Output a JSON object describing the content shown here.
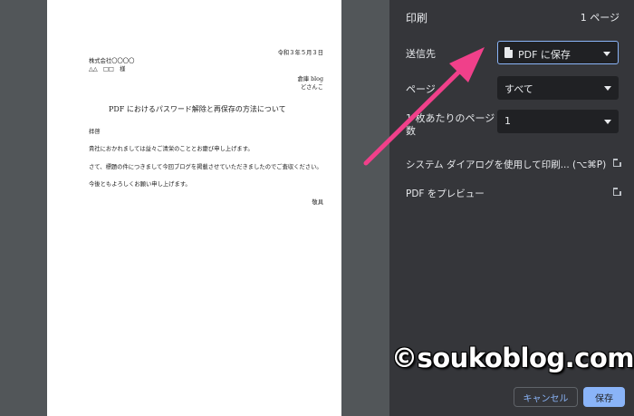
{
  "document": {
    "date": "令和３年５月３日",
    "company": "株式会社〇〇〇〇",
    "recipient": "△△　□□　様",
    "sender_blog": "倉庫 blog",
    "sender_name": "どさんこ",
    "title": "PDF におけるパスワード解除と再保存の方法について",
    "greeting": "拝啓",
    "para1": "貴社におかれましては益々ご清栄のこととお慶び申し上げます。",
    "para2": "さて、標題の件につきまして今回ブログを掲載させていただきましたのでご査収ください。",
    "para3": "今後ともよろしくお願い申し上げます。",
    "closing": "敬具"
  },
  "panel": {
    "title": "印刷",
    "page_count": "1 ページ",
    "destination_label": "送信先",
    "destination_value": "PDF に保存",
    "pages_label": "ページ",
    "pages_value": "すべて",
    "per_sheet_label_1": "1 枚あたりのページ",
    "per_sheet_label_2": "数",
    "per_sheet_value": "1",
    "system_dialog_link": "システム ダイアログを使用して印刷... (⌥⌘P)",
    "preview_pdf_link": "PDF をプレビュー",
    "cancel_button": "キャンセル",
    "save_button": "保存"
  },
  "watermark": "©soukoblog.com",
  "colors": {
    "panel_bg": "#35363a",
    "select_bg": "#202124",
    "accent_blue": "#8ab4f8",
    "annotation_arrow": "#f0408a"
  }
}
